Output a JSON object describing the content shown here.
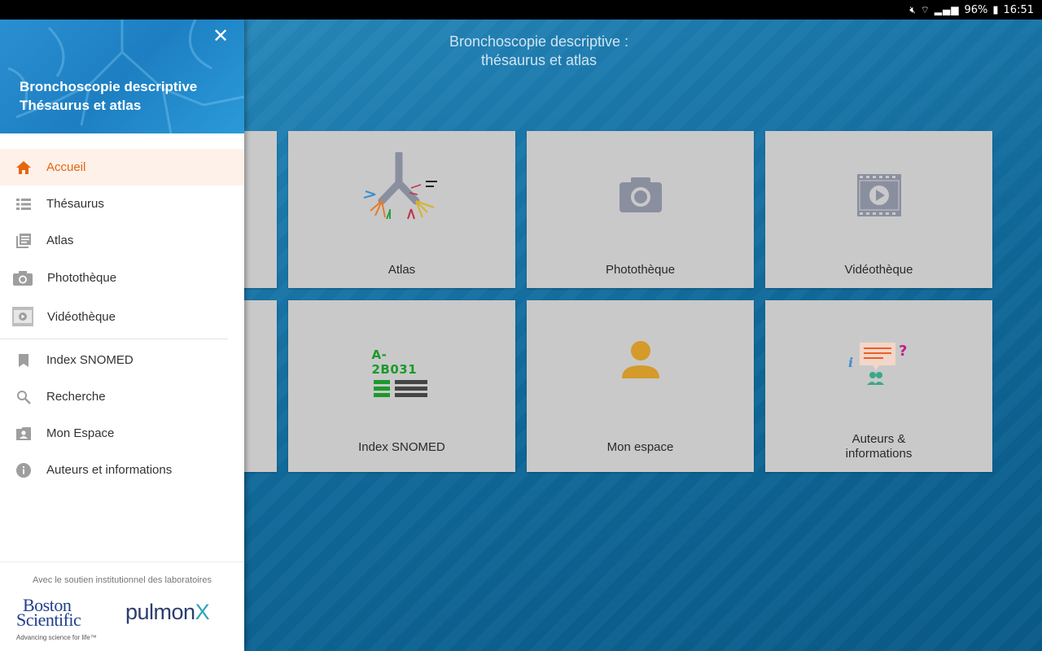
{
  "status_bar": {
    "battery": "96%",
    "time": "16:51",
    "icons": [
      "mute-icon",
      "wifi-icon",
      "signal-icon",
      "battery-icon"
    ]
  },
  "main": {
    "title_line1": "Bronchoscopie descriptive :",
    "title_line2": "thésaurus et atlas",
    "tiles": [
      {
        "label": "Atlas",
        "icon": "bronchial-tree-icon"
      },
      {
        "label": "Photothèque",
        "icon": "camera-icon"
      },
      {
        "label": "Vidéothèque",
        "icon": "video-icon"
      },
      {
        "label": "Index SNOMED",
        "icon": "snomed-code-icon",
        "code": "A-2B031"
      },
      {
        "label": "Mon espace",
        "icon": "person-icon"
      },
      {
        "label_line1": "Auteurs &",
        "label_line2": "informations",
        "icon": "authors-info-icon"
      }
    ]
  },
  "drawer": {
    "title_line1": "Bronchoscopie descriptive",
    "title_line2": "Thésaurus et atlas",
    "close_icon": "close-icon",
    "items": [
      {
        "label": "Accueil",
        "icon": "home-icon",
        "active": true
      },
      {
        "label": "Thésaurus",
        "icon": "list-icon"
      },
      {
        "label": "Atlas",
        "icon": "library-icon"
      },
      {
        "label": "Photothèque",
        "icon": "camera-icon"
      },
      {
        "label": "Vidéothèque",
        "icon": "video-icon"
      },
      {
        "label": "Index SNOMED",
        "icon": "bookmark-icon"
      },
      {
        "label": "Recherche",
        "icon": "search-icon"
      },
      {
        "label": "Mon Espace",
        "icon": "account-box-icon"
      },
      {
        "label": "Auteurs et informations",
        "icon": "info-icon"
      }
    ],
    "footer_text": "Avec le soutien institutionnel des laboratoires",
    "sponsors": {
      "boston_line1": "Boston",
      "boston_line2": "Scientific",
      "boston_tagline": "Advancing science for life™",
      "pulmonx_main": "pulmon",
      "pulmonx_x": "X"
    }
  },
  "colors": {
    "accent": "#e8650c",
    "header_blue": "#1d7fc2",
    "background_blue": "#0b5a86",
    "tile_gray": "#c9c9c9"
  }
}
